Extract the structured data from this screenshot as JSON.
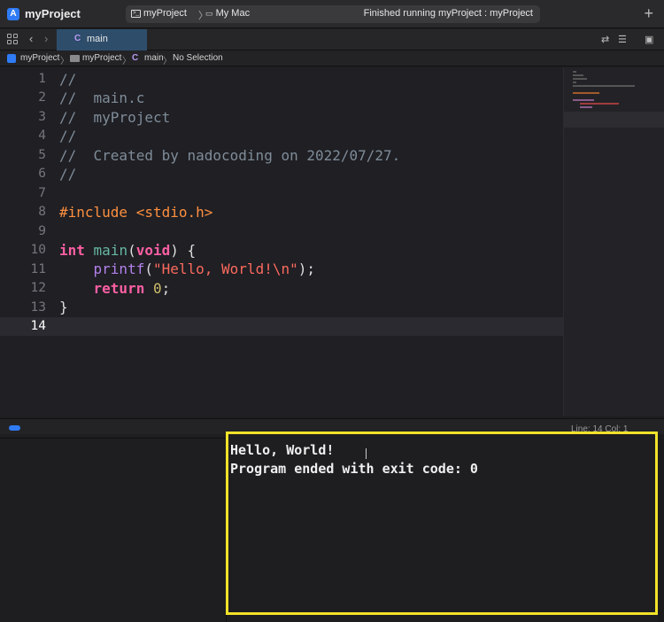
{
  "window": {
    "project_title": "myProject",
    "scheme_target": "myProject",
    "scheme_separator": "〉",
    "scheme_device": "My Mac",
    "status": "Finished running myProject : myProject",
    "add_label": "+"
  },
  "tabbar": {
    "back_label": "‹",
    "forward_label": "›",
    "tab_icon": "C",
    "tab_label": "main"
  },
  "breadcrumb": {
    "project": "myProject",
    "sep": "〉",
    "folder": "myProject",
    "file_icon": "C",
    "file": "main",
    "selection": "No Selection"
  },
  "editor": {
    "line_numbers": [
      "1",
      "2",
      "3",
      "4",
      "5",
      "6",
      "7",
      "8",
      "9",
      "10",
      "11",
      "12",
      "13",
      "14"
    ],
    "current_line": 14,
    "lines": {
      "l1": "//",
      "l2": "//  main.c",
      "l3": "//  myProject",
      "l4": "//",
      "l5": "//  Created by nadocoding on 2022/07/27.",
      "l6": "//",
      "l8_pre": "#include <stdio.h>",
      "l10_kw1": "int",
      "l10_fn": "main",
      "l10_paren1": "(",
      "l10_kw2": "void",
      "l10_rest": ") {",
      "l11_indent": "    ",
      "l11_fn": "printf",
      "l11_open": "(",
      "l11_str": "\"Hello, World!\\n\"",
      "l11_close": ");",
      "l12_indent": "    ",
      "l12_kw": "return",
      "l12_space": " ",
      "l12_num": "0",
      "l12_semi": ";",
      "l13": "}"
    }
  },
  "statusbar": {
    "position": "Line: 14  Col: 1"
  },
  "console": {
    "line1": "Hello, World!",
    "line2": "Program ended with exit code: 0"
  },
  "colors": {
    "accent": "#2f7bf5",
    "highlight_box": "#f2e22a",
    "keyword": "#fc5fa3",
    "string": "#fc6a5d",
    "comment": "#7f8c98",
    "preprocessor": "#fd8f3f"
  }
}
